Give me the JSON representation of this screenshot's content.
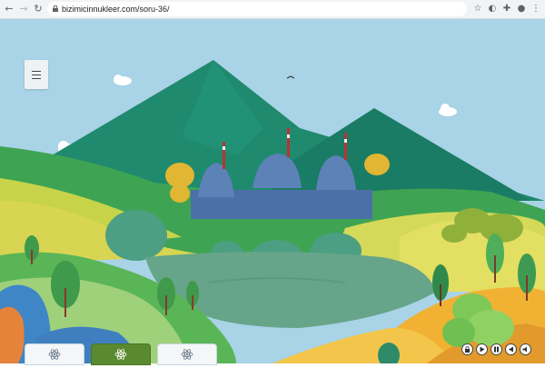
{
  "browser": {
    "url": "bizimicinnukleer.com/soru-36/",
    "icons": [
      "back-arrow-icon",
      "forward-arrow-icon",
      "reload-icon",
      "lock-icon",
      "star-icon",
      "extension-icon",
      "puzzle-icon",
      "menu-lines-icon",
      "profile-icon",
      "kebab-menu-icon"
    ]
  },
  "scene": {
    "sky_color": "#a9d3e6",
    "mountain_color": "#1f8a6e",
    "plant_dome_color": "#5d82b8"
  },
  "bottom_tabs": [
    {
      "icon": "atom-icon",
      "active": false
    },
    {
      "icon": "atom-icon",
      "active": true
    },
    {
      "icon": "atom-icon",
      "active": false
    }
  ],
  "media_controls": [
    "lock-icon",
    "play-icon",
    "pause-icon",
    "previous-icon",
    "volume-icon"
  ]
}
